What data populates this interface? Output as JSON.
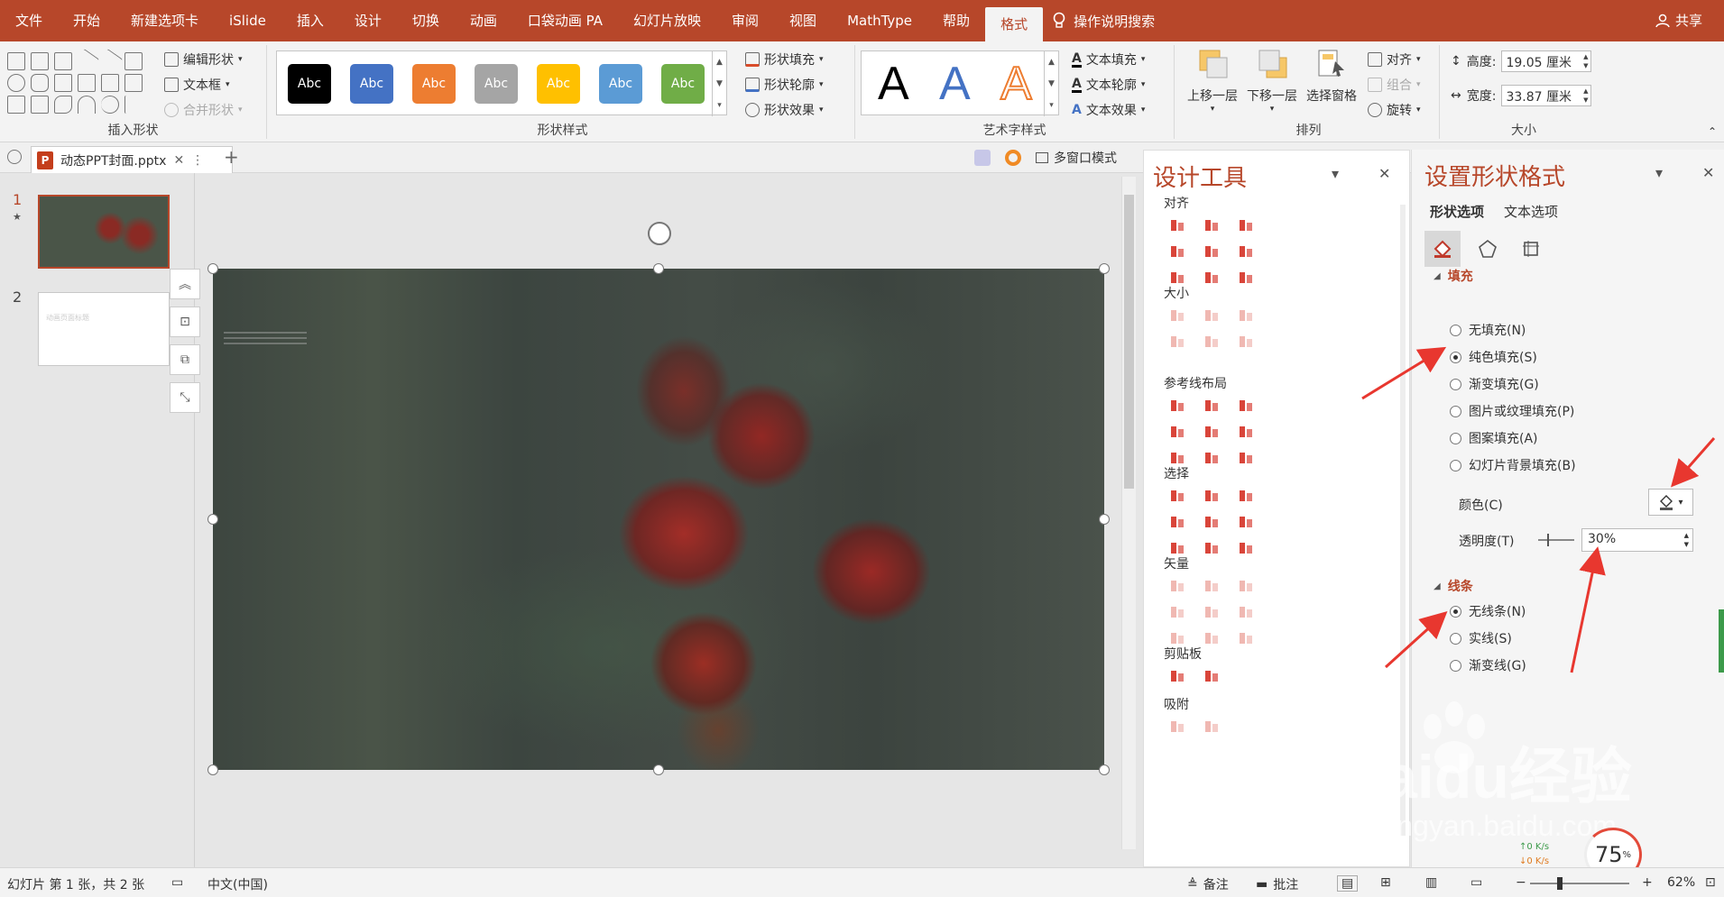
{
  "menu": {
    "items": [
      "文件",
      "开始",
      "新建选项卡",
      "iSlide",
      "插入",
      "设计",
      "切换",
      "动画",
      "口袋动画 PA",
      "幻灯片放映",
      "审阅",
      "视图",
      "MathType",
      "帮助",
      "格式"
    ],
    "search": "操作说明搜索",
    "share": "共享"
  },
  "ribbon": {
    "insert_shapes": {
      "label": "插入形状",
      "edit_shape": "编辑形状",
      "textbox": "文本框",
      "merge_shapes": "合并形状"
    },
    "shape_styles": {
      "label": "形状样式",
      "swatch_text": "Abc",
      "swatches": [
        "#000000",
        "#4472c4",
        "#ed7d31",
        "#a5a5a5",
        "#ffc000",
        "#5b9bd5",
        "#70ad47"
      ],
      "fill": "形状填充",
      "outline": "形状轮廓",
      "effect": "形状效果"
    },
    "wordart": {
      "label": "艺术字样式",
      "letter": "A",
      "text_fill": "文本填充",
      "text_outline": "文本轮廓",
      "text_effect": "文本效果"
    },
    "arrange": {
      "label": "排列",
      "bring_forward": "上移一层",
      "send_backward": "下移一层",
      "selection_pane": "选择窗格",
      "align": "对齐",
      "group": "组合",
      "rotate": "旋转"
    },
    "size": {
      "label": "大小",
      "height_label": "高度:",
      "height": "19.05 厘米",
      "width_label": "宽度:",
      "width": "33.87 厘米"
    }
  },
  "tabs": {
    "doc_name": "动态PPT封面.pptx",
    "multi_window": "多窗口模式"
  },
  "thumbnails": [
    {
      "num": "1",
      "star": "★"
    },
    {
      "num": "2",
      "caption": "动画页面标题"
    }
  ],
  "design_tools": {
    "title": "设计工具",
    "sections": [
      "对齐",
      "大小",
      "参考线布局",
      "选择",
      "矢量",
      "剪贴板",
      "吸附"
    ]
  },
  "format_pane": {
    "title": "设置形状格式",
    "tab_shape": "形状选项",
    "tab_text": "文本选项",
    "fill_header": "填充",
    "fill_options": [
      "无填充(N)",
      "纯色填充(S)",
      "渐变填充(G)",
      "图片或纹理填充(P)",
      "图案填充(A)",
      "幻灯片背景填充(B)"
    ],
    "fill_selected": 1,
    "color_label": "颜色(C)",
    "transparency_label": "透明度(T)",
    "transparency": "30%",
    "line_header": "线条",
    "line_options": [
      "无线条(N)",
      "实线(S)",
      "渐变线(G)"
    ],
    "line_selected": 0
  },
  "net_widget": {
    "up": "↑0 K/s",
    "down": "↓0 K/s",
    "percent": "75",
    "percent_unit": "%"
  },
  "watermark": {
    "text": "Baidu经验",
    "sub": "jingyan.baidu.com"
  },
  "statusbar": {
    "slide_info": "幻灯片 第 1 张，共 2 张",
    "language": "中文(中国)",
    "notes": "备注",
    "comments": "批注",
    "zoom": "62%"
  },
  "colors": {
    "accent": "#b7472a",
    "arrow": "#e8372f"
  }
}
